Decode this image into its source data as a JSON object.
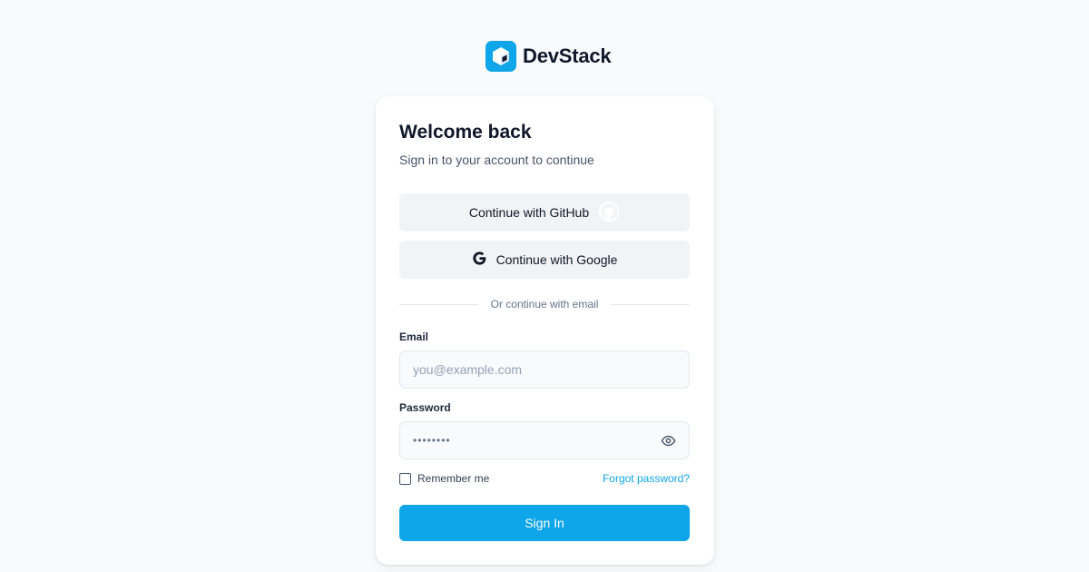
{
  "brand": {
    "name": "DevStack",
    "logo_icon": "cube-icon",
    "accent_color": "#0ea5e9"
  },
  "card": {
    "title": "Welcome back",
    "subtitle": "Sign in to your account to continue"
  },
  "oauth": {
    "github_label": "Continue with GitHub",
    "github_icon": "github-icon",
    "google_label": "Continue with Google",
    "google_icon": "google-icon"
  },
  "divider": {
    "text": "Or continue with email"
  },
  "form": {
    "email_label": "Email",
    "email_placeholder": "you@example.com",
    "email_value": "",
    "password_label": "Password",
    "password_masked": "••••••••",
    "password_toggle_icon": "eye-icon",
    "remember_label": "Remember me",
    "remember_checked": false,
    "forgot_label": "Forgot password?",
    "submit_label": "Sign In"
  }
}
